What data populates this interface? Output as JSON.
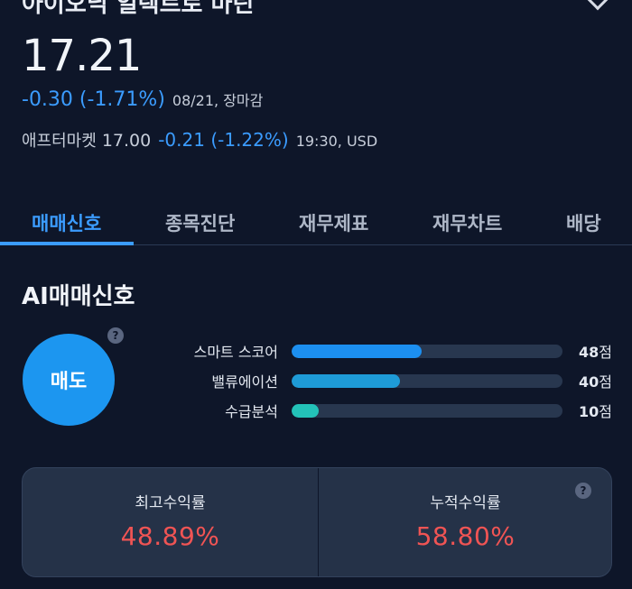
{
  "header": {
    "cut_title": "아이오닉 일렉트로 마틴",
    "price": "17.21",
    "change": "-0.30 (-1.71%)",
    "date_status": "08/21, 장마감",
    "after_label": "애프터마켓",
    "after_price": "17.00",
    "after_change": "-0.21 (-1.22%)",
    "after_time": "19:30, USD"
  },
  "tabs": [
    {
      "label": "매매신호",
      "active": true
    },
    {
      "label": "종목진단"
    },
    {
      "label": "재무제표"
    },
    {
      "label": "재무차트"
    },
    {
      "label": "배당"
    }
  ],
  "ai_signal": {
    "title": "AI매매신호",
    "signal": "매도",
    "help_icon": "question-circle-icon",
    "scores": [
      {
        "name": "스마트 스코어",
        "value": "48",
        "unit": "점",
        "fraction": 0.48,
        "color": "#1c8ff0"
      },
      {
        "name": "밸류에이션",
        "value": "40",
        "unit": "점",
        "fraction": 0.4,
        "color": "#1e9bd7"
      },
      {
        "name": "수급분석",
        "value": "10",
        "unit": "점",
        "fraction": 0.1,
        "color": "#23c2b8"
      }
    ]
  },
  "returns": {
    "max_label": "최고수익률",
    "max_value": "48.89%",
    "cum_label": "누적수익률",
    "cum_value": "58.80%",
    "help_icon": "question-circle-icon"
  },
  "colors": {
    "background": "#0e1629",
    "accent_blue": "#3b9cff",
    "positive_red": "#f05454"
  }
}
